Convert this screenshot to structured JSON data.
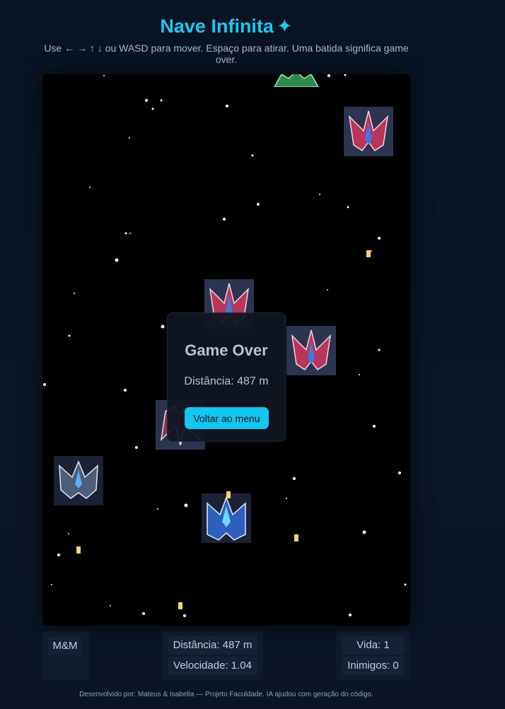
{
  "header": {
    "title": "Nave Infinita",
    "title_icon": "sparkle-icon",
    "title_icon_glyph": "✦",
    "instructions": "Use ← → ↑ ↓ ou WASD para mover. Espaço para atirar. Uma batida significa game over."
  },
  "game_over": {
    "title": "Game Over",
    "distance_text": "Distância: 487 m",
    "button_label": "Voltar ao menu"
  },
  "hud": {
    "logo": "M&M",
    "distance": "Distância: 487 m",
    "speed": "Velocidade: 1.04",
    "life": "Vida: 1",
    "enemies": "Inimigos: 0"
  },
  "footer": "Desenvolvido por: Mateus & Isabella — Projeto Faculdade. IA ajudou com geração do código.",
  "colors": {
    "accent": "#1ec8f2",
    "enemy_ship": "#b9355a",
    "player_ship": "#3a7ad8",
    "bullet": "#f7d36a",
    "background": "#081424"
  }
}
